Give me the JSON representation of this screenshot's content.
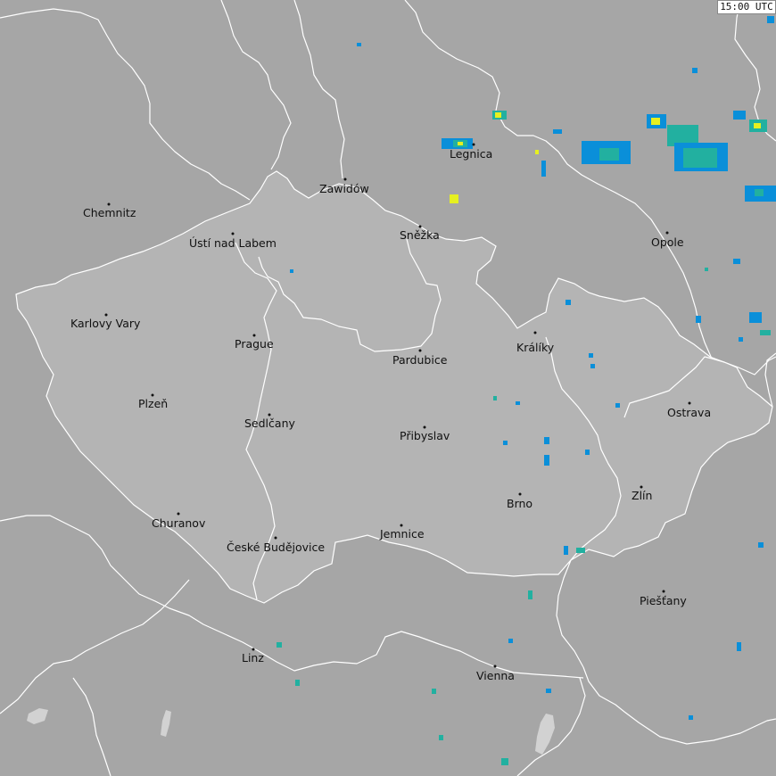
{
  "time_label": "15:00 UTC",
  "colors": {
    "background": "#a6a6a6",
    "country": "#b4b4b4",
    "border": "#ffffff",
    "lake": "#d0d0d0",
    "radar_light": "#0a8fd9",
    "radar_mid": "#22b0a0",
    "radar_strong": "#e6f020"
  },
  "cities": [
    {
      "id": "chemnitz",
      "name": "Chemnitz"
    },
    {
      "id": "usti",
      "name": "Ústí nad Labem"
    },
    {
      "id": "zawidow",
      "name": "Zawidów"
    },
    {
      "id": "legnica",
      "name": "Legnica"
    },
    {
      "id": "snezka",
      "name": "Sněžka"
    },
    {
      "id": "opole",
      "name": "Opole"
    },
    {
      "id": "karlovy-vary",
      "name": "Karlovy Vary"
    },
    {
      "id": "prague",
      "name": "Prague"
    },
    {
      "id": "pardubice",
      "name": "Pardubice"
    },
    {
      "id": "kraliky",
      "name": "Králíky"
    },
    {
      "id": "plzen",
      "name": "Plzeň"
    },
    {
      "id": "sedlcany",
      "name": "Sedlčany"
    },
    {
      "id": "pribyslav",
      "name": "Přibyslav"
    },
    {
      "id": "ostrava",
      "name": "Ostrava"
    },
    {
      "id": "zlin",
      "name": "Zlín"
    },
    {
      "id": "brno",
      "name": "Brno"
    },
    {
      "id": "churanov",
      "name": "Churanov"
    },
    {
      "id": "ceske-budejovice",
      "name": "České Budějovice"
    },
    {
      "id": "jemnice",
      "name": "Jemnice"
    },
    {
      "id": "piestany",
      "name": "Piešťany"
    },
    {
      "id": "linz",
      "name": "Linz"
    },
    {
      "id": "vienna",
      "name": "Vienna"
    }
  ]
}
